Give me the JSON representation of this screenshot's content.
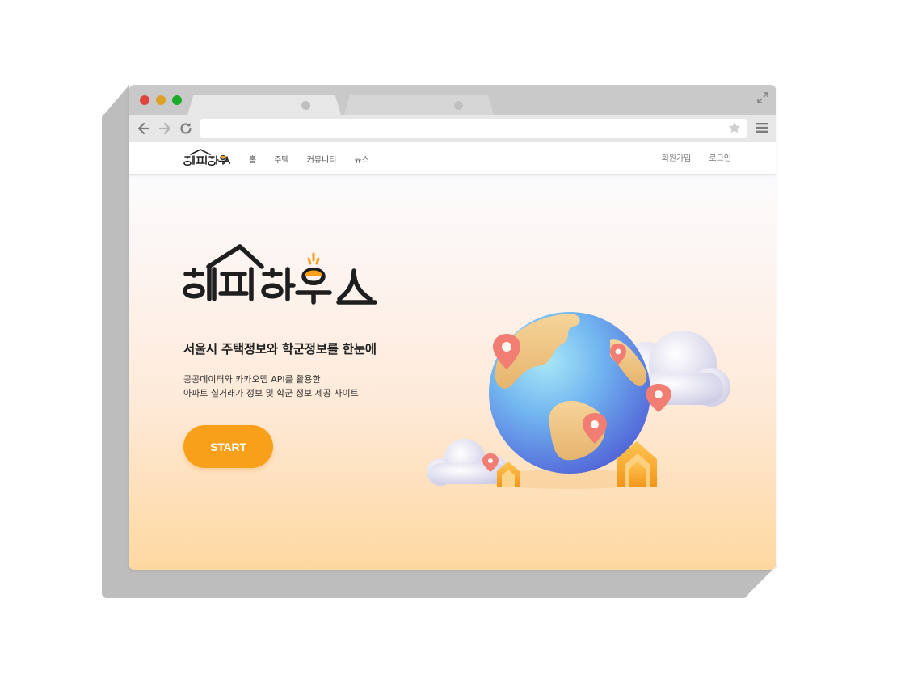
{
  "browser": {
    "tabs": [
      {
        "label": "",
        "active": true
      },
      {
        "label": "",
        "active": false
      }
    ],
    "url": ""
  },
  "site": {
    "brand": "해피하우스",
    "nav": [
      "홈",
      "주택",
      "커뮤니티",
      "뉴스"
    ],
    "auth": {
      "signup": "회원가입",
      "login": "로그인"
    }
  },
  "hero": {
    "heading": "서울시 주택정보와 학군정보를 한눈에",
    "desc_line1": "공공데이터와 카카오맵 API를 활용한",
    "desc_line2": "아파트 실거래가 정보 및 학군 정보 제공 사이트",
    "cta": "START"
  },
  "colors": {
    "accent": "#f9a01a",
    "pin": "#f27d72",
    "globe_ocean": "#6fa8f0",
    "land": "#f1c98a"
  }
}
